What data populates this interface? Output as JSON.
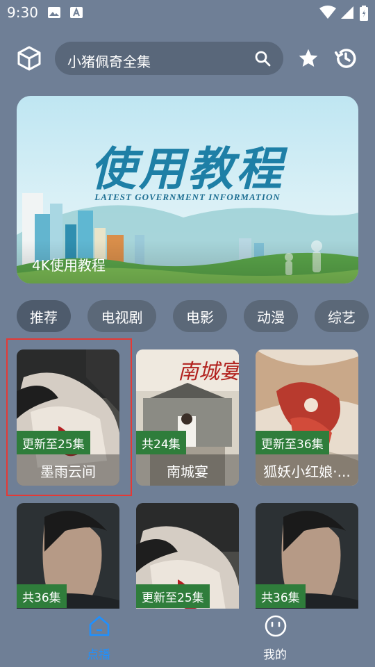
{
  "status": {
    "time": "9:30"
  },
  "search": {
    "query": "小猪佩奇全集"
  },
  "banner": {
    "title": "使用教程",
    "subtitle": "LATEST GOVERNMENT INFORMATION",
    "caption": "4K使用教程"
  },
  "tabs": [
    "推荐",
    "电视剧",
    "电影",
    "动漫",
    "综艺"
  ],
  "cards": [
    {
      "badge": "更新至25集",
      "title": "墨雨云间"
    },
    {
      "badge": "共24集",
      "title": "南城宴"
    },
    {
      "badge": "更新至36集",
      "title": "狐妖小红娘·..."
    },
    {
      "badge": "共36集",
      "title": ""
    },
    {
      "badge": "更新至25集",
      "title": ""
    },
    {
      "badge": "共36集",
      "title": ""
    }
  ],
  "nav": {
    "home": "点播",
    "mine": "我的"
  },
  "colors": {
    "background": "#6f7f96",
    "badge": "#2f7d3b",
    "accent": "#1e90ff",
    "highlight": "#e53935"
  }
}
